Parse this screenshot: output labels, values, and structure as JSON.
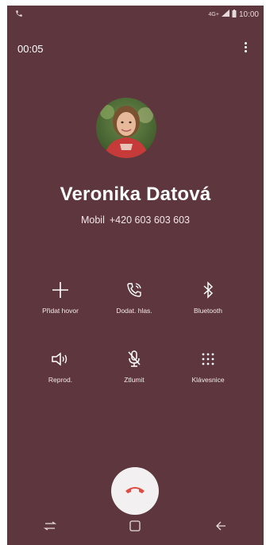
{
  "status_bar": {
    "time": "10:00",
    "network": "4G+"
  },
  "call": {
    "duration": "00:05",
    "contact_name": "Veronika Datová",
    "number_type": "Mobil",
    "number": "+420 603 603 603"
  },
  "actions": [
    {
      "label": "Přidat hovor",
      "icon": "plus-icon"
    },
    {
      "label": "Dodat. hlas.",
      "icon": "voicemail-wifi-icon"
    },
    {
      "label": "Bluetooth",
      "icon": "bluetooth-icon"
    },
    {
      "label": "Reprod.",
      "icon": "speaker-icon"
    },
    {
      "label": "Ztlumit",
      "icon": "mic-off-icon"
    },
    {
      "label": "Klávesnice",
      "icon": "keypad-icon"
    }
  ],
  "colors": {
    "background": "#5e363d",
    "end_call": "#e04b44"
  }
}
